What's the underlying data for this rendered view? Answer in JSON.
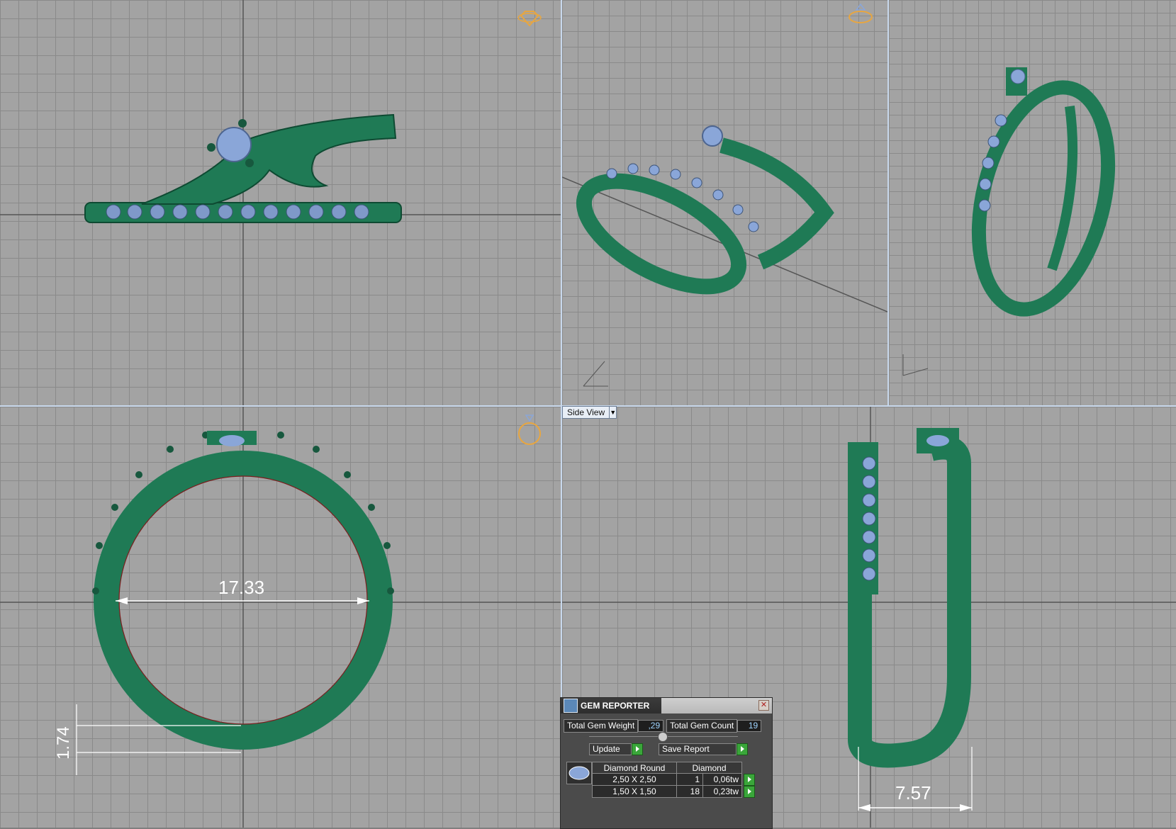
{
  "viewports": {
    "side_view_label": "Side View",
    "dim_ring_inner": "17.33",
    "dim_band_thickness": "1.74",
    "dim_side_width": "7.57"
  },
  "gem_reporter": {
    "title": "GEM REPORTER",
    "total_weight_label": "Total Gem Weight",
    "total_weight_value": ",29",
    "total_count_label": "Total Gem Count",
    "total_count_value": "19",
    "update_label": "Update",
    "save_label": "Save Report",
    "headers": [
      "Diamond Round",
      "Diamond"
    ],
    "rows": [
      {
        "size": "2,50 X 2,50",
        "count": "1",
        "weight": "0,06tw"
      },
      {
        "size": "1,50 X 1,50",
        "count": "18",
        "weight": "0,23tw"
      }
    ]
  },
  "colors": {
    "metal": "#1f7a55",
    "gem": "#8aa6d8",
    "viewport_bg": "#a3a3a3",
    "gizmo": "#e8a640"
  }
}
